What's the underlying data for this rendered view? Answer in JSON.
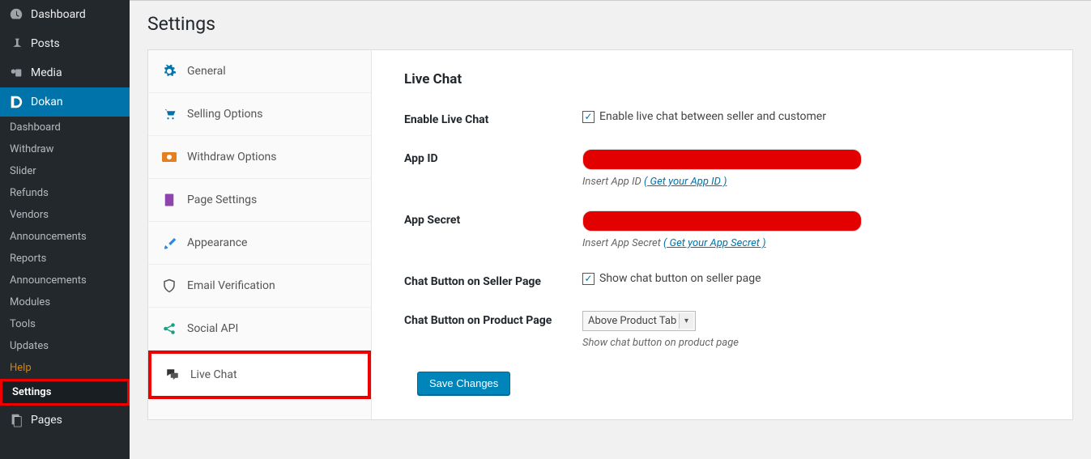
{
  "sidebar": {
    "dashboard": "Dashboard",
    "posts": "Posts",
    "media": "Media",
    "dokan": "Dokan",
    "sub": [
      "Dashboard",
      "Withdraw",
      "Slider",
      "Refunds",
      "Vendors",
      "Announcements",
      "Reports",
      "Announcements",
      "Modules",
      "Tools",
      "Updates",
      "Help",
      "Settings"
    ],
    "pages": "Pages"
  },
  "page_title": "Settings",
  "tabs": [
    {
      "label": "General"
    },
    {
      "label": "Selling Options"
    },
    {
      "label": "Withdraw Options"
    },
    {
      "label": "Page Settings"
    },
    {
      "label": "Appearance"
    },
    {
      "label": "Email Verification"
    },
    {
      "label": "Social API"
    },
    {
      "label": "Live Chat"
    }
  ],
  "panel": {
    "heading": "Live Chat",
    "enable_label": "Enable Live Chat",
    "enable_text": "Enable live chat between seller and customer",
    "appid_label": "App ID",
    "appid_helper": "Insert App ID ",
    "appid_link": "( Get your App ID )",
    "appsecret_label": "App Secret",
    "appsecret_helper": "Insert App Secret ",
    "appsecret_link": "( Get your App Secret )",
    "chat_seller_label": "Chat Button on Seller Page",
    "chat_seller_text": "Show chat button on seller page",
    "chat_product_label": "Chat Button on Product Page",
    "chat_product_select": "Above Product Tab",
    "chat_product_helper": "Show chat button on product page",
    "save_button": "Save Changes"
  }
}
